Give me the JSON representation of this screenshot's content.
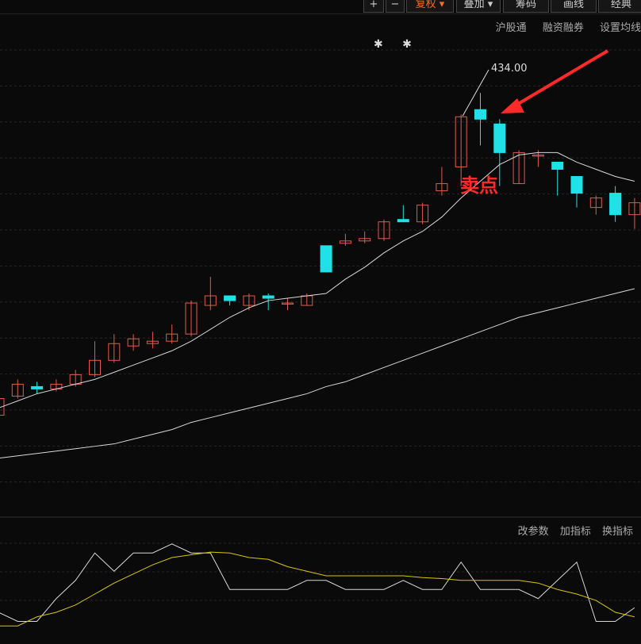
{
  "toolbar": {
    "buttons": [
      "+",
      "−",
      "复权",
      "叠加",
      "筹码",
      "画线",
      "经典"
    ],
    "active": "复权"
  },
  "main_links": [
    "沪股通",
    "融资融券",
    "设置均线"
  ],
  "sub_links": [
    "改参数",
    "加指标",
    "换指标"
  ],
  "markers": "✱ ✱",
  "colors": {
    "up": "#e05a4e",
    "down": "#20e0e8",
    "ma_short": "#d8d8d8",
    "ma_long": "#d8d8d8",
    "kdj_white": "#d8d8d8",
    "kdj_yellow": "#d8c800",
    "annotation": "#ff2a2a"
  },
  "chart_data": {
    "type": "candlestick",
    "high_label": "434.00",
    "annotation": "卖点",
    "candles": [
      {
        "o": 288,
        "c": 295,
        "h": 296,
        "l": 286
      },
      {
        "o": 296,
        "c": 301,
        "h": 303,
        "l": 295
      },
      {
        "o": 300,
        "c": 299,
        "h": 302,
        "l": 297
      },
      {
        "o": 299,
        "c": 301,
        "h": 303,
        "l": 298
      },
      {
        "o": 301,
        "c": 305,
        "h": 307,
        "l": 300
      },
      {
        "o": 305,
        "c": 311,
        "h": 319,
        "l": 304
      },
      {
        "o": 311,
        "c": 318,
        "h": 322,
        "l": 310
      },
      {
        "o": 317,
        "c": 320,
        "h": 322,
        "l": 315
      },
      {
        "o": 318,
        "c": 319,
        "h": 323,
        "l": 316
      },
      {
        "o": 319,
        "c": 322,
        "h": 326,
        "l": 318
      },
      {
        "o": 322,
        "c": 335,
        "h": 336,
        "l": 321
      },
      {
        "o": 334,
        "c": 338,
        "h": 346,
        "l": 332
      },
      {
        "o": 338,
        "c": 336,
        "h": 338,
        "l": 334
      },
      {
        "o": 334,
        "c": 338,
        "h": 339,
        "l": 332
      },
      {
        "o": 338,
        "c": 337,
        "h": 339,
        "l": 332
      },
      {
        "o": 335,
        "c": 335,
        "h": 337,
        "l": 332
      },
      {
        "o": 334,
        "c": 338,
        "h": 339,
        "l": 334
      },
      {
        "o": 359,
        "c": 348,
        "h": 359,
        "l": 348
      },
      {
        "o": 360,
        "c": 361,
        "h": 364,
        "l": 359
      },
      {
        "o": 361,
        "c": 362,
        "h": 365,
        "l": 360
      },
      {
        "o": 362,
        "c": 369,
        "h": 370,
        "l": 361
      },
      {
        "o": 370,
        "c": 369,
        "h": 376,
        "l": 369
      },
      {
        "o": 369,
        "c": 376,
        "h": 377,
        "l": 368
      },
      {
        "o": 382,
        "c": 385,
        "h": 392,
        "l": 380
      },
      {
        "o": 392,
        "c": 413,
        "h": 414,
        "l": 384
      },
      {
        "o": 416,
        "c": 412,
        "h": 423,
        "l": 401
      },
      {
        "o": 410,
        "c": 398,
        "h": 412,
        "l": 384
      },
      {
        "o": 385,
        "c": 398,
        "h": 399,
        "l": 385
      },
      {
        "o": 397,
        "c": 397,
        "h": 399,
        "l": 392
      },
      {
        "o": 394,
        "c": 391,
        "h": 394,
        "l": 380
      },
      {
        "o": 388,
        "c": 381,
        "h": 388,
        "l": 375
      },
      {
        "o": 375,
        "c": 379,
        "h": 380,
        "l": 372
      },
      {
        "o": 381,
        "c": 372,
        "h": 384,
        "l": 369
      },
      {
        "o": 372,
        "c": 377,
        "h": 379,
        "l": 366
      }
    ],
    "ma_short": [
      291,
      294,
      297,
      299,
      301,
      303,
      306,
      309,
      312,
      315,
      319,
      324,
      329,
      333,
      336,
      337,
      338,
      339,
      345,
      350,
      356,
      361,
      365,
      371,
      379,
      386,
      393,
      397,
      398,
      398,
      394,
      391,
      388,
      386
    ],
    "ma_long": [
      270,
      271,
      272,
      273,
      274,
      275,
      276,
      278,
      280,
      282,
      285,
      287,
      289,
      291,
      293,
      295,
      297,
      300,
      302,
      305,
      308,
      311,
      314,
      317,
      320,
      323,
      326,
      329,
      331,
      333,
      335,
      337,
      339,
      341
    ],
    "price_range": [
      245,
      437
    ],
    "sub": {
      "white": [
        20,
        10,
        10,
        35,
        55,
        85,
        65,
        85,
        85,
        95,
        85,
        85,
        45,
        45,
        45,
        45,
        55,
        55,
        45,
        45,
        45,
        55,
        45,
        45,
        75,
        45,
        45,
        45,
        35,
        55,
        75,
        10,
        10,
        25
      ],
      "yellow": [
        5,
        5,
        15,
        20,
        28,
        40,
        52,
        62,
        72,
        80,
        83,
        86,
        85,
        80,
        78,
        70,
        65,
        60,
        60,
        60,
        60,
        60,
        58,
        57,
        55,
        55,
        55,
        55,
        52,
        45,
        40,
        33,
        20,
        15
      ],
      "range": [
        0,
        100
      ]
    }
  }
}
